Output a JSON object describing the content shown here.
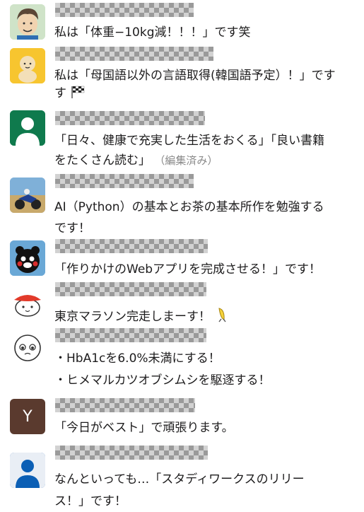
{
  "messages": [
    {
      "lines": [
        "私は「体重−10kg減！！！」です笑"
      ],
      "avatar": "man-cartoon-avatar"
    },
    {
      "lines": [
        "私は「母国語以外の言語取得(韓国語予定）！」です",
        "す"
      ],
      "avatar": "baby-emoji-avatar",
      "emoji": "checkered-flag-icon"
    },
    {
      "lines": [
        "「日々、健康で充実した生活をおくる」「良い書籍",
        "をたくさん読む」"
      ],
      "edited": "（編集済み）",
      "avatar": "default-user-avatar"
    },
    {
      "lines": [
        "AI（Python）の基本とお茶の基本所作を勉強する",
        "です！"
      ],
      "avatar": "motorcycle-photo-avatar"
    },
    {
      "lines": [
        "「作りかけのWebアプリを完成させる！」です！"
      ],
      "avatar": "kumamon-avatar"
    },
    {
      "lines": [
        "東京マラソン完走しまーす！"
      ],
      "avatar": "sushi-character-avatar",
      "emoji": "running-banana-icon"
    },
    {
      "lines": [
        "・HbA1cを6.0%未満にする！",
        "・ヒメマルカツオブシムシを駆逐する！"
      ],
      "avatar": "pleading-face-avatar"
    },
    {
      "lines": [
        "「今日がベスト」で頑張ります。"
      ],
      "avatar": "letter-avatar",
      "avatar_letter": "Y",
      "avatar_color": "#5a3a2e"
    },
    {
      "lines": [
        "なんといっても…「スタディワークスのリリー",
        "ス！」です！"
      ],
      "avatar": "default-user-avatar"
    }
  ],
  "colors": {
    "default_avatar_bg": "#0f7a4d",
    "default_avatar_bg2": "#0b5fb5"
  }
}
